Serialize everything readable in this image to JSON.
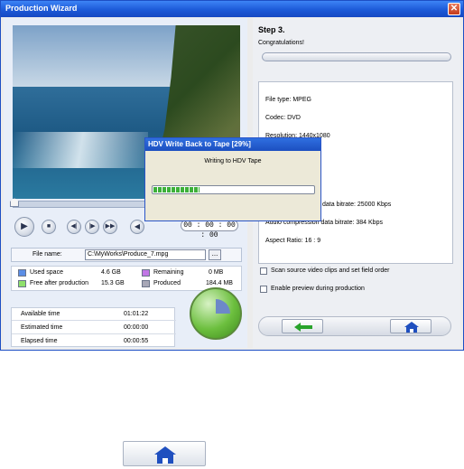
{
  "window": {
    "title": "Production Wizard"
  },
  "player": {
    "timecode": "00 : 00 : 00 : 00"
  },
  "file": {
    "label": "File name:",
    "value": "C:\\MyWorks\\Produce_7.mpg",
    "browse_label": "..."
  },
  "legend": {
    "used_label": "Used space",
    "used_value": "4.6 GB",
    "free_label": "Free after production",
    "free_value": "15.3 GB",
    "remaining_label": "Remaining",
    "remaining_value": "0 MB",
    "produced_label": "Produced",
    "produced_value": "184.4 MB",
    "colors": {
      "used": "#5b8ee6",
      "free": "#8fe06b",
      "remaining": "#c277e6",
      "produced": "#a7a7b6"
    }
  },
  "times": [
    {
      "label": "Available time",
      "value": "01:01:22"
    },
    {
      "label": "Estimated time",
      "value": "00:00:00"
    },
    {
      "label": "Elapsed time",
      "value": "00:00:55"
    }
  ],
  "wizard": {
    "step": "Step 3.",
    "congrats": "Congratulations!",
    "info": {
      "file_type": "File type: MPEG",
      "codec": "Codec: DVD",
      "resolution_partial": "Resolution: 1440x1080",
      "video_bitrate_partial": "data bitrate: 25000 Kbps",
      "audio_bitrate_partial": "Audio compression data bitrate: 384 Kbps",
      "aspect": "Aspect Ratio: 16 : 9"
    },
    "options": [
      "Scan source video clips and set field order",
      "Enable preview during production"
    ]
  },
  "dialog": {
    "title": "HDV Write Back to Tape [29%]",
    "message": "Writing to HDV Tape",
    "progress": 0.29
  },
  "accent": "#1c5ad8"
}
